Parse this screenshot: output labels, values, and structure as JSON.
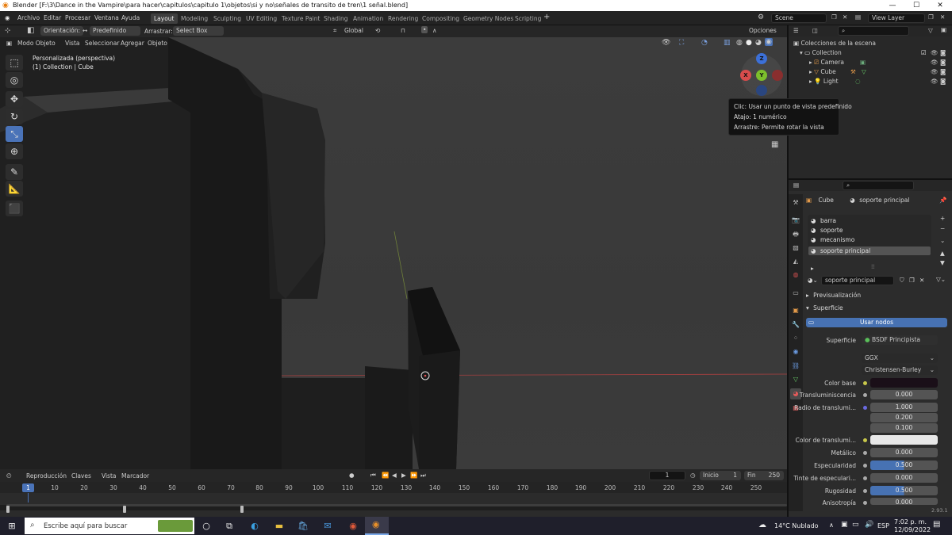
{
  "window": {
    "title": "Blender [F:\\3\\Dance in the Vampire\\para hacer\\capitulos\\capitulo 1\\objetos\\si y no\\señales de transito de tren\\1 señal.blend]",
    "min": "—",
    "max": "☐",
    "close": "✕"
  },
  "menu": [
    "Archivo",
    "Editar",
    "Procesar",
    "Ventana",
    "Ayuda"
  ],
  "workspaces": [
    "Layout",
    "Modeling",
    "Sculpting",
    "UV Editing",
    "Texture Paint",
    "Shading",
    "Animation",
    "Rendering",
    "Compositing",
    "Geometry Nodes",
    "Scripting"
  ],
  "scene": "Scene",
  "view_layer": "View Layer",
  "toolhdr": {
    "orientation_label": "Orientación:",
    "orientation": "Predefinido",
    "drag_label": "Arrastrar:",
    "drag": "Select Box",
    "transform": "Global",
    "options": "Opciones"
  },
  "viewhdr": {
    "mode": "Modo Objeto",
    "items": [
      "Vista",
      "Seleccionar",
      "Agregar",
      "Objeto"
    ]
  },
  "viewport": {
    "info1": "Personalizada (perspectiva)",
    "info2": "(1) Collection | Cube"
  },
  "gizmo": {
    "z": "Z",
    "x": "X",
    "y": "Y"
  },
  "tooltip": [
    "Clic: Usar un punto de vista predefinido",
    "Atajo: 1 numérico",
    "Arrastre: Permite rotar la vista"
  ],
  "timehdr": {
    "items": [
      "Reproducción",
      "Claves",
      "Vista",
      "Marcador"
    ],
    "current": "1",
    "start_label": "Inicio",
    "start": "1",
    "end_label": "Fin",
    "end": "250"
  },
  "timeline": {
    "frames": [
      "10",
      "20",
      "30",
      "40",
      "50",
      "60",
      "70",
      "80",
      "90",
      "100",
      "110",
      "120",
      "130",
      "140",
      "150",
      "160",
      "170",
      "180",
      "190",
      "200",
      "210",
      "220",
      "230",
      "240",
      "250"
    ],
    "current": "1"
  },
  "outliner": {
    "root": "Colecciones de la escena",
    "collection": "Collection",
    "objects": [
      "Camera",
      "Cube",
      "Light"
    ]
  },
  "properties": {
    "object": "Cube",
    "material": "soporte principal",
    "slots": [
      "barra",
      "soporte",
      "mecanismo",
      "soporte principal"
    ],
    "material_field": "soporte principal",
    "sections": {
      "preview": "Previsualización",
      "surface": "Superficie"
    },
    "use_nodes": "Usar nodos",
    "surface_label": "Superficie",
    "surface_value": "BSDF Principista",
    "distribution": "GGX",
    "subsurface_method": "Christensen-Burley",
    "rows": [
      {
        "label": "Color base",
        "value": ""
      },
      {
        "label": "Transluminiscencia",
        "value": "0.000"
      },
      {
        "label": "Radio de translumi...",
        "value": "1.000"
      },
      {
        "label": "",
        "value": "0.200"
      },
      {
        "label": "",
        "value": "0.100"
      },
      {
        "label": "Color de translumi...",
        "value": ""
      },
      {
        "label": "Metálico",
        "value": "0.000"
      },
      {
        "label": "Especularidad",
        "value": "0.500"
      },
      {
        "label": "Tinte de especulari...",
        "value": "0.000"
      },
      {
        "label": "Rugosidad",
        "value": "0.500"
      },
      {
        "label": "Anisotropía",
        "value": "0.000"
      }
    ]
  },
  "version": "2.93.1",
  "taskbar": {
    "search": "Escribe aquí para buscar",
    "weather": "14°C  Nublado",
    "lang": "ESP",
    "time": "7:02 p. m.",
    "date": "12/09/2022"
  }
}
